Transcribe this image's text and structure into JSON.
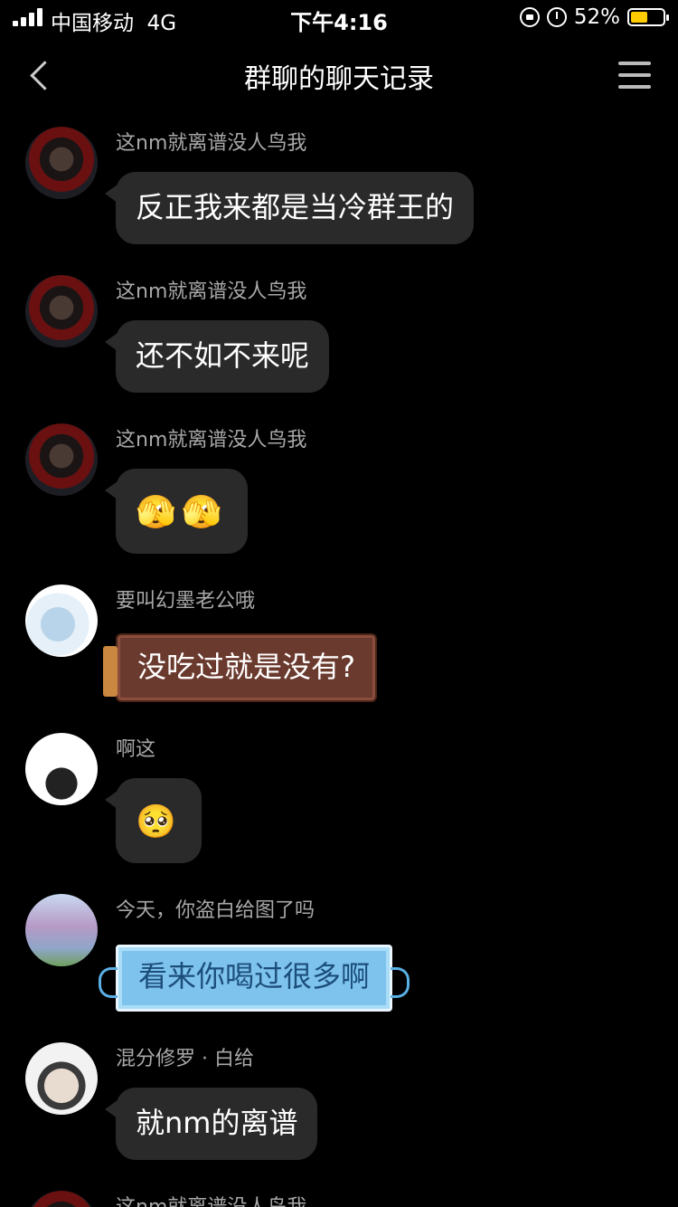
{
  "status_bar": {
    "carrier": "中国移动",
    "network": "4G",
    "time": "下午4:16",
    "battery_percent": "52%",
    "battery_level": 0.52,
    "battery_color": "#ffcc00",
    "icons": [
      "signal-icon",
      "rotation-lock-icon",
      "alarm-icon",
      "battery-icon"
    ]
  },
  "header": {
    "title": "群聊的聊天记录",
    "back_icon": "chevron-left-icon",
    "menu_icon": "menu-icon"
  },
  "messages": [
    {
      "nickname": "这nm就离谱没人鸟我",
      "text": "反正我来都是当冷群王的",
      "bubble": "default"
    },
    {
      "nickname": "这nm就离谱没人鸟我",
      "text": "还不如不来呢",
      "bubble": "default"
    },
    {
      "nickname": "这nm就离谱没人鸟我",
      "emojis": [
        "🫣",
        "🫣"
      ],
      "bubble": "default"
    },
    {
      "nickname": "要叫幻墨老公哦",
      "text": "没吃过就是没有?",
      "bubble": "chocolate"
    },
    {
      "nickname": "啊这",
      "emojis": [
        "🥺"
      ],
      "bubble": "default"
    },
    {
      "nickname": "今天，你盗白给图了吗",
      "text": "看来你喝过很多啊",
      "bubble": "blue"
    },
    {
      "nickname": "混分修罗 · 白给",
      "text": "就nm的离谱",
      "bubble": "default"
    },
    {
      "nickname": "这nm就离谱没人鸟我",
      "bubble": "default"
    }
  ],
  "colors": {
    "background": "#000000",
    "bubble": "#2a2a2a",
    "nickname": "#a8a8a8"
  }
}
